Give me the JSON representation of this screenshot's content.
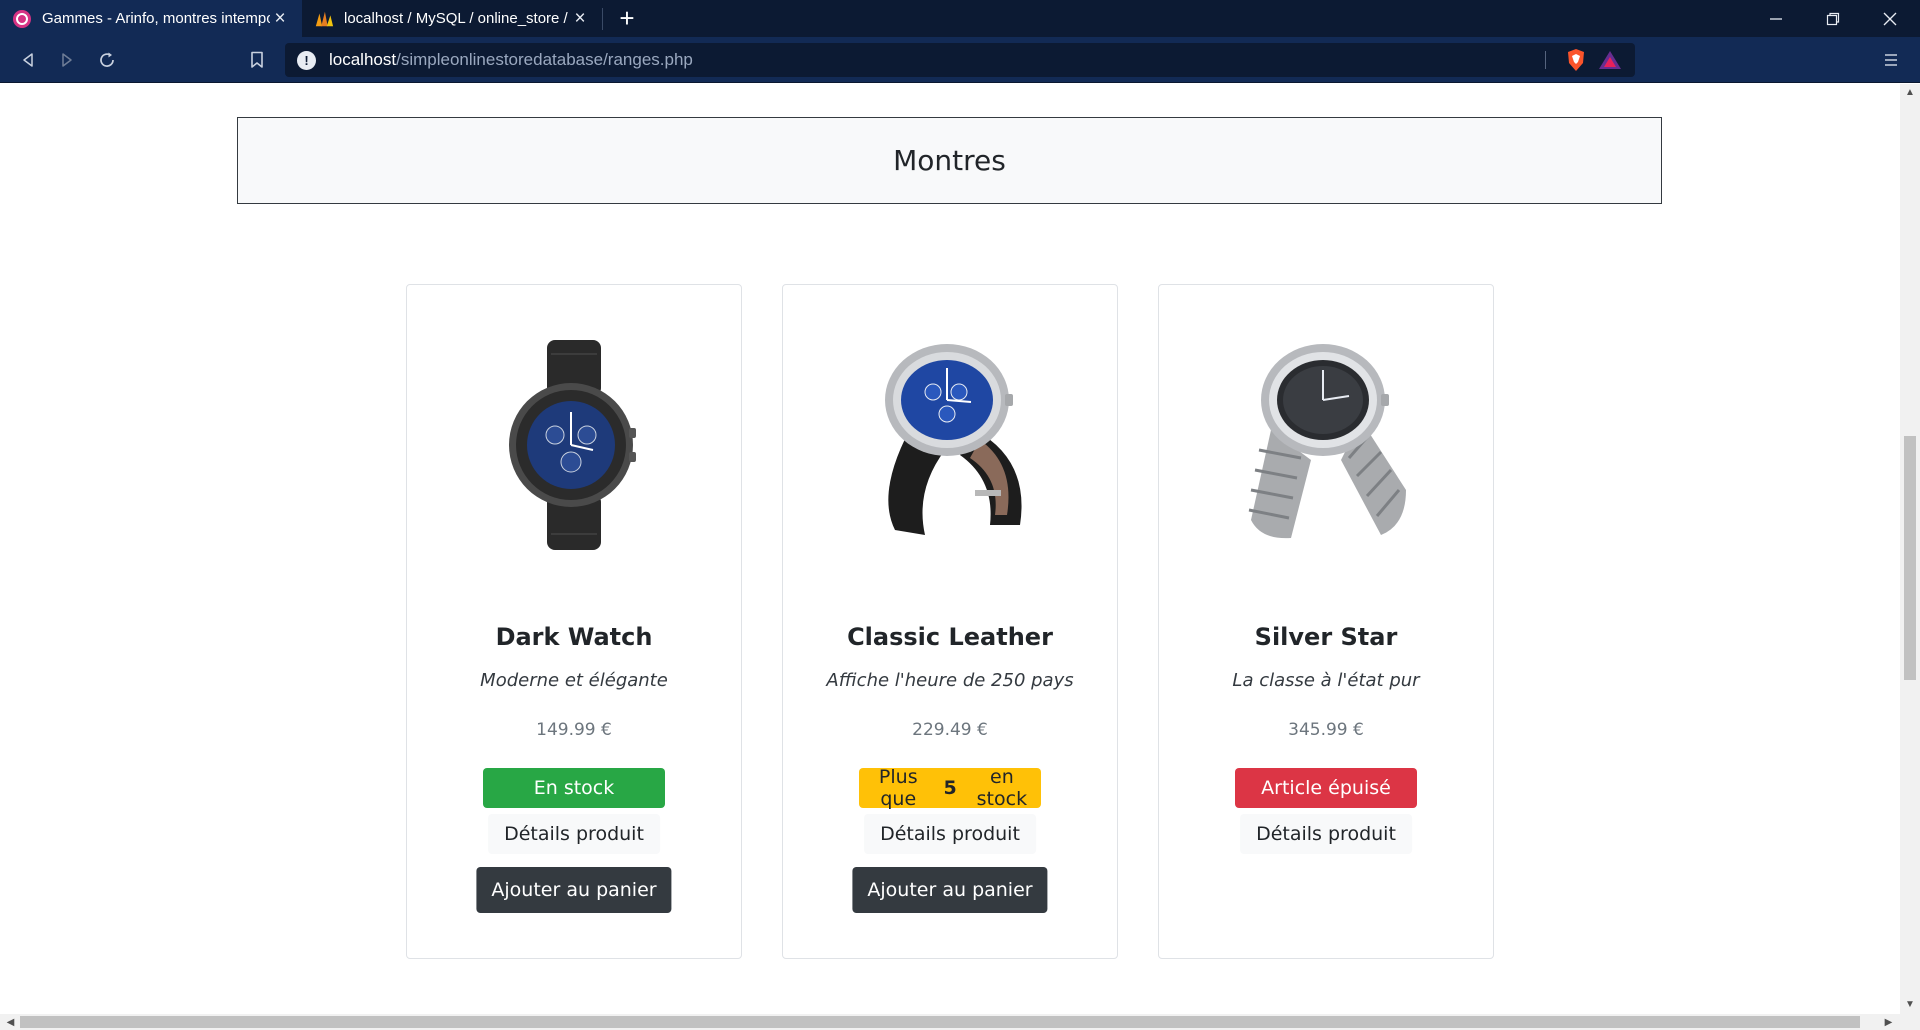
{
  "browser": {
    "tabs": [
      {
        "title": "Gammes - Arinfo, montres intemporelles",
        "active": true
      },
      {
        "title": "localhost / MySQL / online_store / ranges",
        "active": false
      }
    ],
    "new_tab": "+",
    "window_controls": {
      "minimize": "—",
      "restore": "❐",
      "close": "✕"
    },
    "url": {
      "host": "localhost",
      "path": "/simpleonlinestoredatabase/ranges.php"
    }
  },
  "page": {
    "range_title": "Montres",
    "products": [
      {
        "name": "Dark Watch",
        "description": "Moderne et élégante",
        "price": "149.99 €",
        "stock": {
          "type": "green",
          "text": "En stock"
        },
        "details_label": "Détails produit",
        "cart_label": "Ajouter au panier"
      },
      {
        "name": "Classic Leather",
        "description": "Affiche l'heure de 250 pays",
        "price": "229.49 €",
        "stock": {
          "type": "yellow",
          "prefix": "Plus que",
          "count": "5",
          "suffix": "en stock"
        },
        "details_label": "Détails produit",
        "cart_label": "Ajouter au panier"
      },
      {
        "name": "Silver Star",
        "description": "La classe à l'état pur",
        "price": "345.99 €",
        "stock": {
          "type": "red",
          "text": "Article épuisé"
        },
        "details_label": "Détails produit"
      }
    ]
  },
  "colors": {
    "success": "#28a745",
    "warning": "#ffc107",
    "danger": "#dc3545",
    "dark": "#343a40",
    "chrome": "#0c1a33"
  }
}
